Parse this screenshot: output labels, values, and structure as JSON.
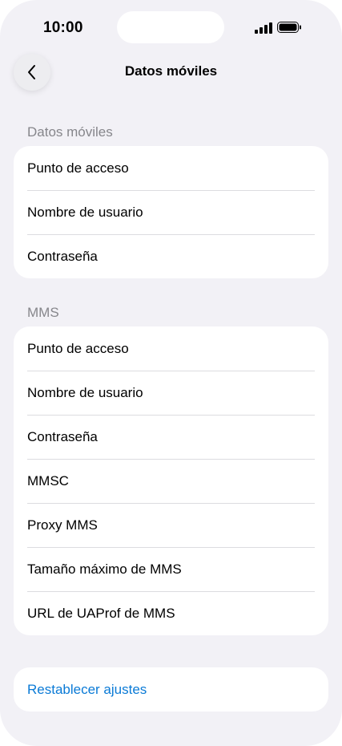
{
  "status_bar": {
    "time": "10:00"
  },
  "nav": {
    "title": "Datos móviles",
    "back_icon": "chevron-left-icon"
  },
  "sections": {
    "data": {
      "header": "Datos móviles",
      "items": [
        "Punto de acceso",
        "Nombre de usuario",
        "Contraseña"
      ]
    },
    "mms": {
      "header": "MMS",
      "items": [
        "Punto de acceso",
        "Nombre de usuario",
        "Contraseña",
        "MMSC",
        "Proxy MMS",
        "Tamaño máximo de MMS",
        "URL de UAProf de MMS"
      ]
    },
    "reset": {
      "label": "Restablecer ajustes"
    }
  },
  "colors": {
    "background": "#f2f1f6",
    "card": "#ffffff",
    "link": "#0a7ad6",
    "secondary_text": "#86868b"
  }
}
